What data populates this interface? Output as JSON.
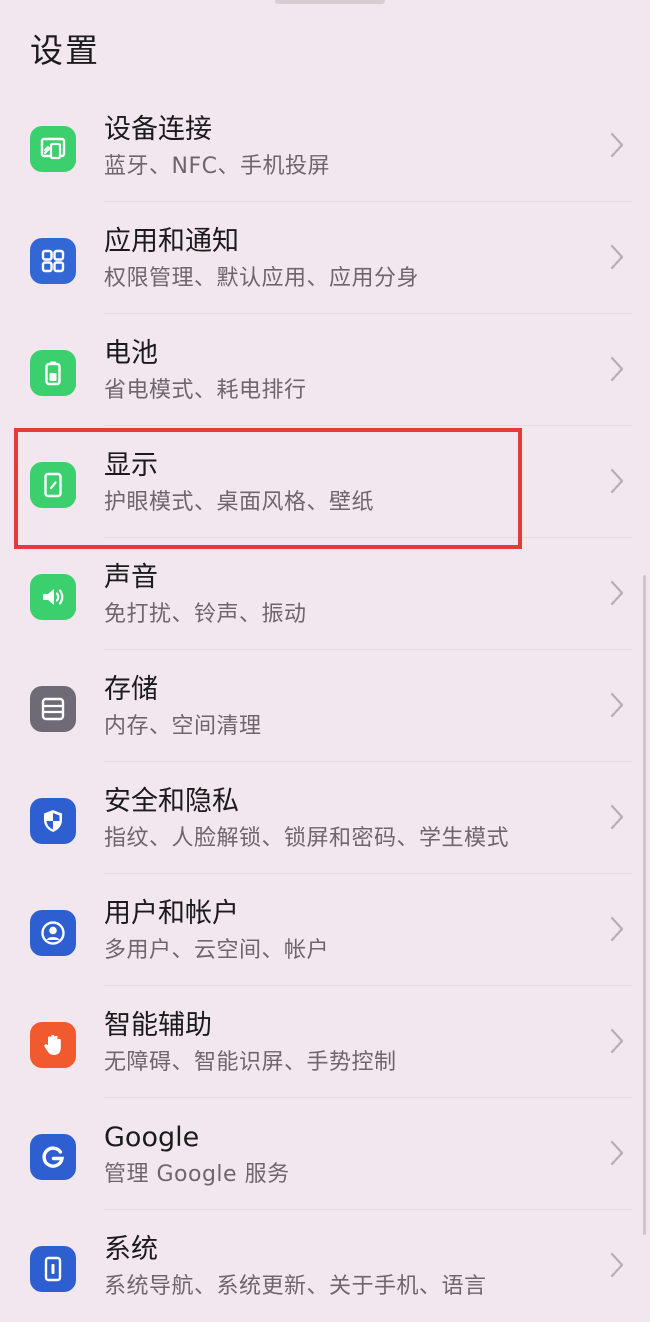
{
  "header": {
    "title": "设置"
  },
  "items": [
    {
      "title": "设备连接",
      "subtitle": "蓝牙、NFC、手机投屏",
      "icon": "device-connection-icon",
      "color": "#3ccf6e"
    },
    {
      "title": "应用和通知",
      "subtitle": "权限管理、默认应用、应用分身",
      "icon": "apps-grid-icon",
      "color": "#3467d6"
    },
    {
      "title": "电池",
      "subtitle": "省电模式、耗电排行",
      "icon": "battery-icon",
      "color": "#3ccf6e"
    },
    {
      "title": "显示",
      "subtitle": "护眼模式、桌面风格、壁纸",
      "icon": "display-icon",
      "color": "#3ccf6e"
    },
    {
      "title": "声音",
      "subtitle": "免打扰、铃声、振动",
      "icon": "speaker-icon",
      "color": "#3ccf6e"
    },
    {
      "title": "存储",
      "subtitle": "内存、空间清理",
      "icon": "storage-icon",
      "color": "#6e6b76"
    },
    {
      "title": "安全和隐私",
      "subtitle": "指纹、人脸解锁、锁屏和密码、学生模式",
      "icon": "shield-icon",
      "color": "#2d5fd1"
    },
    {
      "title": "用户和帐户",
      "subtitle": "多用户、云空间、帐户",
      "icon": "user-account-icon",
      "color": "#2d5fd1"
    },
    {
      "title": "智能辅助",
      "subtitle": "无障碍、智能识屏、手势控制",
      "icon": "hand-icon",
      "color": "#f05a2e"
    },
    {
      "title": "Google",
      "subtitle": "管理 Google 服务",
      "icon": "google-icon",
      "color": "#2d5fd1"
    },
    {
      "title": "系统",
      "subtitle": "系统导航、系统更新、关于手机、语言",
      "icon": "system-phone-icon",
      "color": "#2d5fd1"
    }
  ],
  "highlight": {
    "item_title": "显示",
    "color": "#e53b3b"
  }
}
